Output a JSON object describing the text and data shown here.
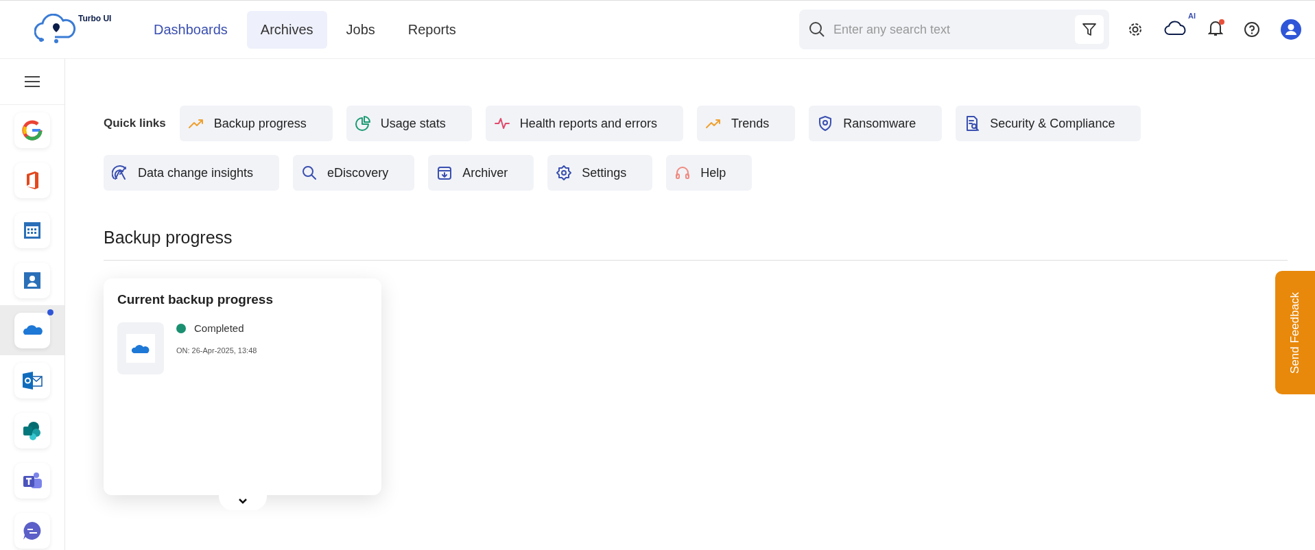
{
  "header": {
    "logo_text": "Turbo UI",
    "tabs": [
      {
        "label": "Dashboards",
        "selected": true,
        "hovered": false
      },
      {
        "label": "Archives",
        "selected": false,
        "hovered": true
      },
      {
        "label": "Jobs",
        "selected": false,
        "hovered": false
      },
      {
        "label": "Reports",
        "selected": false,
        "hovered": false
      }
    ],
    "search": {
      "placeholder": "Enter any search text"
    },
    "ai_badge": "AI",
    "notifications_unread": true
  },
  "sidebar": {
    "items": [
      {
        "kind": "google",
        "selected": false,
        "badge": false
      },
      {
        "kind": "office",
        "selected": false,
        "badge": false
      },
      {
        "kind": "calendar",
        "selected": false,
        "badge": false
      },
      {
        "kind": "contacts",
        "selected": false,
        "badge": false
      },
      {
        "kind": "onedrive",
        "selected": true,
        "badge": true
      },
      {
        "kind": "outlook",
        "selected": false,
        "badge": false
      },
      {
        "kind": "sharepoint",
        "selected": false,
        "badge": false
      },
      {
        "kind": "teams",
        "selected": false,
        "badge": false
      },
      {
        "kind": "chat",
        "selected": false,
        "badge": false
      }
    ]
  },
  "quick_links": {
    "label": "Quick links",
    "links": [
      {
        "label": "Backup progress",
        "kind": "trend"
      },
      {
        "label": "Usage stats",
        "kind": "pie"
      },
      {
        "label": "Health reports and errors",
        "kind": "pulse"
      },
      {
        "label": "Trends",
        "kind": "trend"
      },
      {
        "label": "Ransomware",
        "kind": "shield"
      },
      {
        "label": "Security & Compliance",
        "kind": "document"
      },
      {
        "label": "Data change insights",
        "kind": "radar"
      },
      {
        "label": "eDiscovery",
        "kind": "search"
      },
      {
        "label": "Archiver",
        "kind": "archive"
      },
      {
        "label": "Settings",
        "kind": "gear"
      },
      {
        "label": "Help",
        "kind": "headset"
      }
    ]
  },
  "section": {
    "title": "Backup progress",
    "card": {
      "title": "Current backup progress",
      "status": {
        "label": "Completed",
        "kind": "success"
      },
      "date": "ON: 26-Apr-2025, 13:48"
    }
  },
  "feedback": {
    "label": "Send Feedback"
  }
}
